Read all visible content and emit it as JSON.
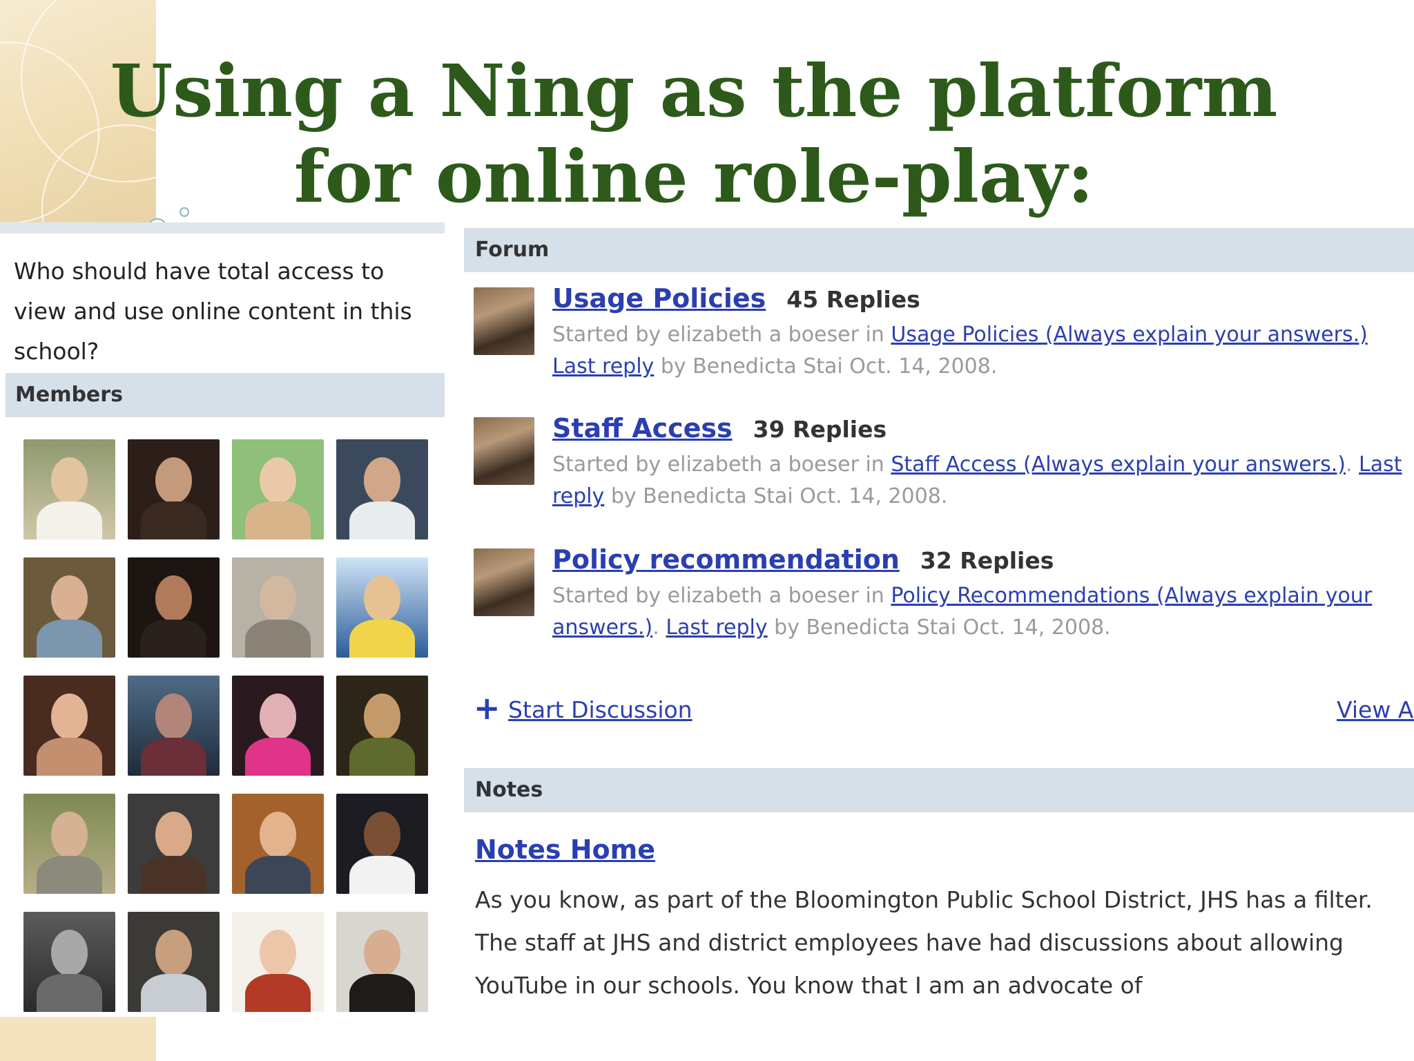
{
  "slide": {
    "title_line1": "Using a Ning as the platform",
    "title_line2": "for online role-play:"
  },
  "sidebar": {
    "question": "Who should have total access to view and use online content in this school?",
    "members_header": "Members",
    "member_count_shown": 20
  },
  "forum": {
    "header": "Forum",
    "topics": [
      {
        "title": "Usage Policies",
        "replies": "45 Replies",
        "started_prefix": "Started by elizabeth a boeser in",
        "category": "Usage Policies (Always explain your answers.)",
        "separator": "",
        "last_reply": "Last reply",
        "last_reply_suffix": "by Benedicta Stai Oct. 14, 2008."
      },
      {
        "title": "Staff Access",
        "replies": "39 Replies",
        "started_prefix": "Started by elizabeth a boeser in",
        "category": "Staff Access (Always explain your answers.)",
        "separator": ".",
        "last_reply": "Last reply",
        "last_reply_suffix": "by Benedicta Stai Oct. 14, 2008."
      },
      {
        "title": "Policy recommendation",
        "replies": "32 Replies",
        "started_prefix": "Started by elizabeth a boeser in",
        "category": "Policy Recommendations (Always explain your answers.)",
        "separator": ".",
        "last_reply": "Last reply",
        "last_reply_suffix": "by Benedicta Stai Oct. 14, 2008."
      }
    ],
    "start_discussion": "Start Discussion",
    "view_all": "View Al"
  },
  "notes": {
    "header": "Notes",
    "home_link": "Notes Home",
    "body": "As you know, as part of the Bloomington Public School District, JHS has a filter.  The staff at JHS and district employees have had discussions about allowing YouTube in our schools.  You know that I am an advocate of"
  },
  "colors": {
    "title_green": "#2d5a1b",
    "link_blue": "#2b3fb0",
    "section_header_bg": "#d6e0e8",
    "deco_beige": "#f3e3bf"
  }
}
